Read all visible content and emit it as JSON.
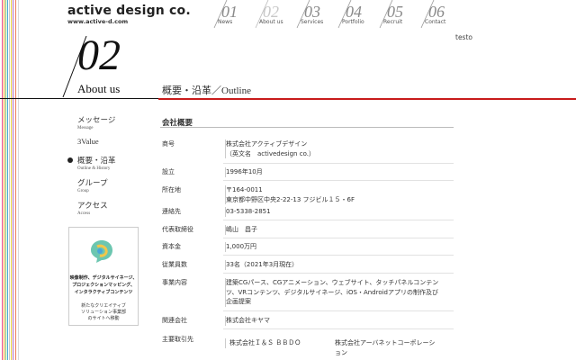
{
  "logo": {
    "title": "active design co.",
    "url": "www.active-d.com"
  },
  "nav": [
    {
      "num": "01",
      "label": "News",
      "active": false
    },
    {
      "num": "02",
      "label": "About us",
      "active": true
    },
    {
      "num": "03",
      "label": "Services",
      "active": false
    },
    {
      "num": "04",
      "label": "Portfolio",
      "active": false
    },
    {
      "num": "05",
      "label": "Recruit",
      "active": false
    },
    {
      "num": "06",
      "label": "Contact",
      "active": false
    }
  ],
  "user": "testo",
  "section": {
    "num": "02",
    "name": "About us",
    "title": "概要・沿革／Outline"
  },
  "sidebar": [
    {
      "jp": "メッセージ",
      "en": "Message",
      "current": false
    },
    {
      "jp": "3Value",
      "en": "",
      "current": false
    },
    {
      "jp": "概要・沿革",
      "en": "Outline & History",
      "current": true
    },
    {
      "jp": "グループ",
      "en": "Group",
      "current": false
    },
    {
      "jp": "アクセス",
      "en": "Access",
      "current": false
    }
  ],
  "banner": {
    "line1": "映像制作、デジタルサイネージ、",
    "line2": "プロジェクションマッピング、",
    "line3": "インタラクティブコンテンツ",
    "line4": "新たなクリエイティブ",
    "line5": "ソリューション事業部",
    "line6": "のサイトへ移動"
  },
  "company": {
    "heading": "会社概要",
    "rows": [
      {
        "k": "商号",
        "v": [
          "株式会社アクティブデザイン",
          "（英文名　activedesign co.）"
        ]
      },
      {
        "k": "設立",
        "v": [
          "1996年10月"
        ]
      },
      {
        "k": "所在地",
        "v": [
          "〒164-0011",
          "東京都中野区中央2-22-13 フジビル１５・6F"
        ]
      },
      {
        "k": "連絡先",
        "v": [
          "03-5338-2851"
        ]
      },
      {
        "k": "代表取締役",
        "v": [
          "嶋山　昌子"
        ]
      },
      {
        "k": "資本金",
        "v": [
          "1,000万円"
        ]
      },
      {
        "k": "従業員数",
        "v": [
          "33名（2021年3月現在）"
        ]
      },
      {
        "k": "事業内容",
        "v": [
          "建築CGパース、CGアニメーション、ウェブサイト、タッチパネルコンテン",
          "ツ、VRコンテンツ、デジタルサイネージ、iOS・Androidアプリの制作及び",
          "企画提案"
        ]
      },
      {
        "k": "関連会社",
        "v": [
          "株式会社キヤマ"
        ]
      },
      {
        "k": "主要取引先",
        "v": [
          "株式会社Ｉ＆Ｓ ＢＢＤＯ"
        ],
        "v2": [
          "株式会社アーバネットコーポレーシ",
          "ョン"
        ]
      }
    ]
  },
  "colors": {
    "accent_red": "#c81c1c",
    "text": "#333333"
  }
}
